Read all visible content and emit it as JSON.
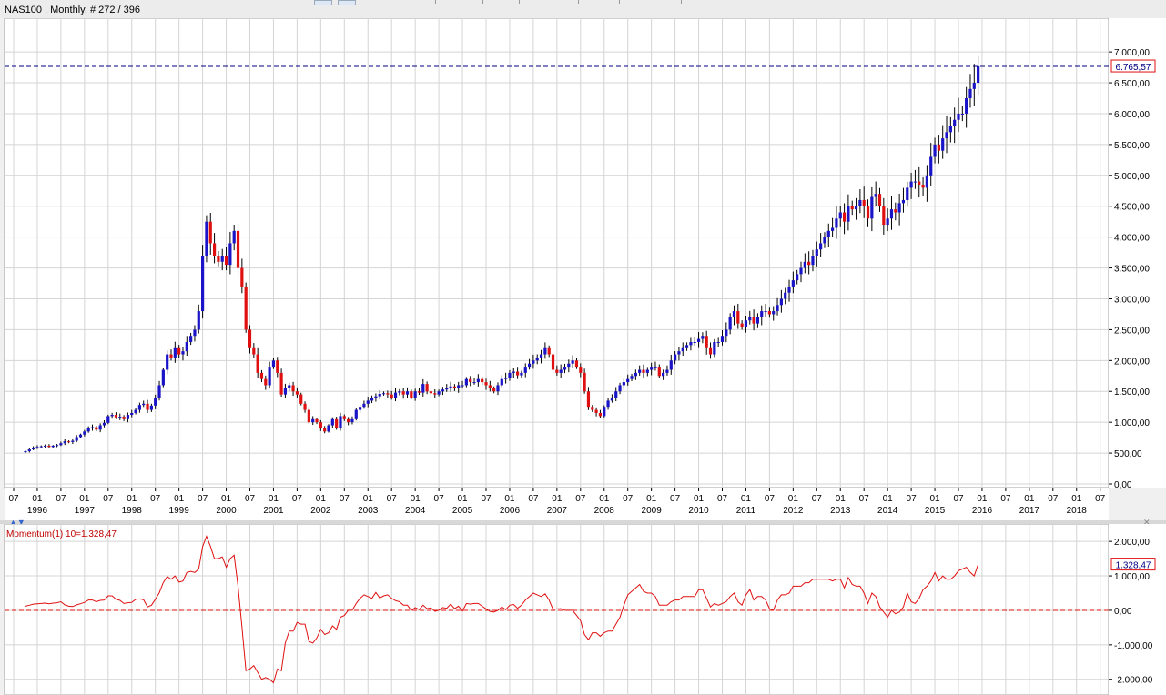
{
  "header": {
    "title": "NAS100 , Monthly, # 272 / 396"
  },
  "colors": {
    "up": "#1a14c8",
    "down": "#e01010",
    "grid": "#d4d4d4",
    "price_line": "#000080",
    "momentum": "#e01010"
  },
  "chart_data": [
    {
      "type": "candlestick",
      "title": "NAS100 , Monthly, # 272 / 396",
      "ylim": [
        0,
        7400
      ],
      "y_ticks": [
        "7.000,00",
        "6.500,00",
        "6.000,00",
        "5.500,00",
        "5.000,00",
        "4.500,00",
        "4.000,00",
        "3.500,00",
        "3.000,00",
        "2.500,00",
        "2.000,00",
        "1.500,00",
        "1.000,00",
        "500,00",
        "0,00"
      ],
      "y_tick_values": [
        7000,
        6500,
        6000,
        5500,
        5000,
        4500,
        4000,
        3500,
        3000,
        2500,
        2000,
        1500,
        1000,
        500,
        0
      ],
      "current_price_label": "6.765,57",
      "current_price": 6765.57,
      "x_month_labels": [
        "07",
        "01",
        "07",
        "01",
        "07",
        "01",
        "07",
        "01",
        "07",
        "01",
        "07",
        "01",
        "07",
        "01",
        "07",
        "01",
        "07",
        "01",
        "07",
        "01",
        "07",
        "01",
        "07",
        "01",
        "07",
        "01",
        "07",
        "01",
        "07",
        "01",
        "07",
        "01",
        "07",
        "01",
        "07",
        "01",
        "07",
        "01",
        "07",
        "01",
        "07",
        "01",
        "07",
        "01",
        "07",
        "01",
        "07"
      ],
      "x_year_labels": [
        "1996",
        "1997",
        "1998",
        "1999",
        "2000",
        "2001",
        "2002",
        "2003",
        "2004",
        "2005",
        "2006",
        "2007",
        "2008",
        "2009",
        "2010",
        "2011",
        "2012",
        "2013",
        "2014",
        "2015",
        "2016",
        "2017",
        "2018"
      ],
      "start": "1995-10",
      "closes": [
        530,
        560,
        590,
        600,
        610,
        620,
        600,
        620,
        630,
        660,
        690,
        680,
        700,
        760,
        800,
        850,
        900,
        920,
        880,
        950,
        990,
        1100,
        1120,
        1080,
        1090,
        1050,
        1120,
        1150,
        1200,
        1280,
        1300,
        1200,
        1270,
        1400,
        1600,
        1850,
        2100,
        2050,
        2200,
        2100,
        2150,
        2300,
        2400,
        2500,
        2800,
        3700,
        4250,
        3900,
        3700,
        3600,
        3700,
        3550,
        3900,
        4100,
        3500,
        3200,
        2500,
        2200,
        2100,
        1800,
        1700,
        1600,
        1900,
        2000,
        1800,
        1450,
        1550,
        1600,
        1500,
        1450,
        1300,
        1200,
        1000,
        1050,
        1000,
        900,
        850,
        950,
        1050,
        900,
        1100,
        1050,
        1000,
        1050,
        1200,
        1250,
        1300,
        1350,
        1400,
        1420,
        1460,
        1470,
        1450,
        1400,
        1480,
        1500,
        1450,
        1500,
        1400,
        1500,
        1480,
        1620,
        1500,
        1470,
        1450,
        1500,
        1530,
        1560,
        1580,
        1550,
        1600,
        1600,
        1700,
        1650,
        1650,
        1700,
        1650,
        1600,
        1550,
        1500,
        1600,
        1700,
        1720,
        1800,
        1820,
        1760,
        1800,
        1900,
        1950,
        2000,
        2050,
        2100,
        2200,
        2100,
        1850,
        1800,
        1850,
        1900,
        1950,
        2000,
        1900,
        1800,
        1500,
        1250,
        1200,
        1150,
        1100,
        1250,
        1350,
        1400,
        1500,
        1600,
        1650,
        1700,
        1750,
        1800,
        1850,
        1800,
        1850,
        1900,
        1900,
        1750,
        1800,
        1850,
        2000,
        2100,
        2150,
        2200,
        2250,
        2300,
        2300,
        2350,
        2400,
        2200,
        2100,
        2300,
        2300,
        2400,
        2500,
        2700,
        2800,
        2600,
        2550,
        2650,
        2700,
        2600,
        2700,
        2800,
        2800,
        2750,
        2800,
        2900,
        3000,
        3100,
        3200,
        3300,
        3400,
        3500,
        3600,
        3550,
        3700,
        3800,
        3900,
        4000,
        4100,
        4150,
        4300,
        4400,
        4250,
        4500,
        4450,
        4500,
        4600,
        4500,
        4300,
        4650,
        4700,
        4500,
        4200,
        4300,
        4450,
        4400,
        4550,
        4600,
        4800,
        4900,
        4900,
        4850,
        4800,
        5000,
        5300,
        5500,
        5400,
        5600,
        5700,
        5800,
        5900,
        6000,
        6000,
        6250,
        6400,
        6500,
        6765.57
      ],
      "momentum_series_name": "Momentum(1) 10",
      "momentum_label": "Momentum(1) 10=1.328,47",
      "momentum_value_label": "1.328,47",
      "momentum_value": 1328.47,
      "momentum_ylim": [
        -2350,
        2400
      ],
      "momentum_ticks": [
        "2.000,00",
        "1.000,00",
        "0,00",
        "-1.000,00",
        "-2.000,00"
      ],
      "momentum_tick_values": [
        2000,
        1000,
        0,
        -1000,
        -2000
      ]
    }
  ]
}
